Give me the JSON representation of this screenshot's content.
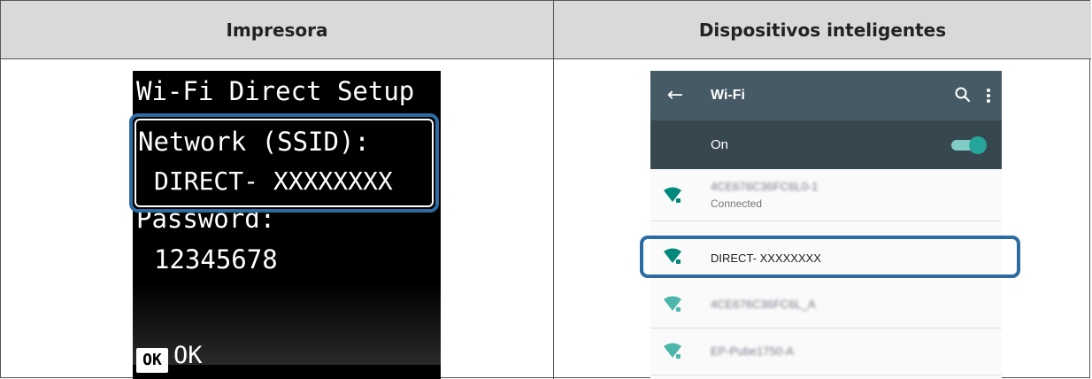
{
  "table": {
    "header_left": "Impresora",
    "header_right": "Dispositivos inteligentes"
  },
  "printer_screen": {
    "title": "Wi-Fi Direct Setup",
    "ssid_label": "Network (SSID):",
    "ssid_value": "DIRECT- XXXXXXXX",
    "password_label": "Password:",
    "password_value": "12345678",
    "ok_key": "OK",
    "ok_label": "OK"
  },
  "phone_screen": {
    "back_icon": "arrow-left-icon",
    "title": "Wi-Fi",
    "search_icon": "search-icon",
    "more_icon": "more-vert-icon",
    "toggle_label": "On",
    "toggle_state": "on",
    "networks": [
      {
        "name": "4CE676C36FC6L0-1",
        "status": "Connected",
        "blurred": true
      },
      {
        "name": "DIRECT- XXXXXXXX",
        "status": "",
        "blurred": false
      },
      {
        "name": "4CE676C36FC6L_A",
        "status": "",
        "blurred": true
      },
      {
        "name": "EP-Pube1750-A",
        "status": "",
        "blurred": true
      }
    ]
  },
  "colors": {
    "header_bg": "#d9d9d9",
    "highlight_border": "#2d6ca3",
    "appbar": "#455a64",
    "onbar": "#37474f",
    "toggle_accent": "#26a69a",
    "wifi_icon": "#00897b"
  }
}
